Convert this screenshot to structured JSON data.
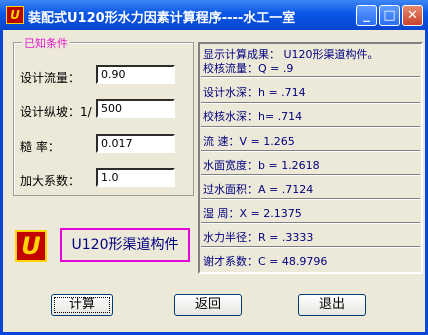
{
  "window": {
    "title": "装配式U120形水力因素计算程序----水工一室",
    "min": "_",
    "max": "□",
    "close": "✕",
    "icon_glyph": "U"
  },
  "inputs": {
    "group_title": "已知条件",
    "flow_label": "设计流量：",
    "flow_value": "0.90",
    "slope_label": "设计纵坡：1/",
    "slope_value": "500",
    "rough_label": "糙    率：",
    "rough_value": "0.017",
    "height_label": "加大系数：",
    "height_value": "1.0"
  },
  "logo": {
    "glyph": "U",
    "product": "U120形渠道构件"
  },
  "results": {
    "header": "显示计算成果： U120形渠道构件。",
    "flow": "校核流量：Q = .9",
    "depth": "设计水深：h = .714",
    "check_depth": "校核水深：h= .714",
    "velocity": "流    速：V = 1.265",
    "width": "水面宽度：b = 1.2618",
    "area": "过水面积：A = .7124",
    "perimeter": "湿    周：X = 2.1375",
    "radius": "水力半径：R = .3333",
    "chezy": "谢才系数：C = 48.9796"
  },
  "buttons": {
    "calc": "计算",
    "back": "返回",
    "exit": "退出"
  }
}
